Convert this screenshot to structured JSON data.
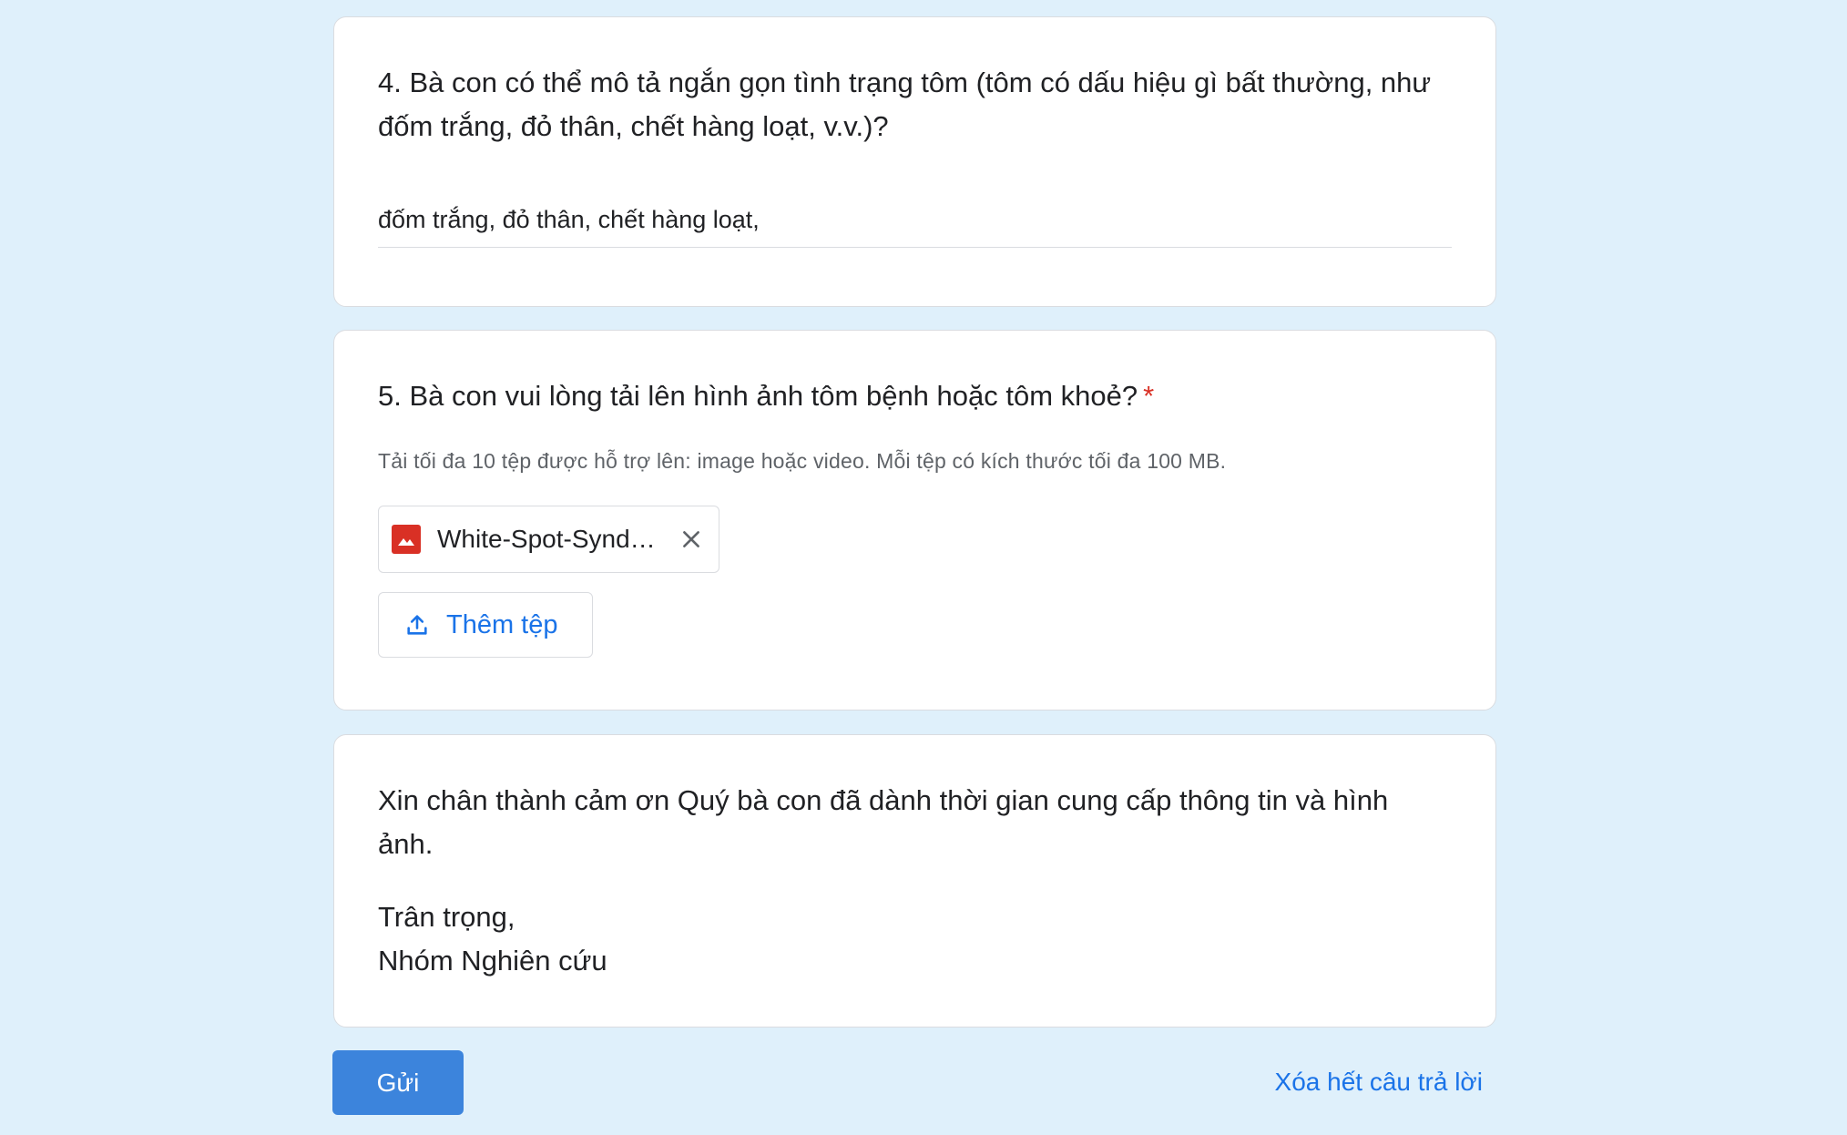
{
  "questions": {
    "q4": {
      "title": "4. Bà con có thể mô tả ngắn gọn tình trạng tôm (tôm có dấu hiệu gì bất thường, như đốm trắng, đỏ thân, chết hàng loạt, v.v.)?",
      "answer": "đốm trắng, đỏ thân, chết hàng loạt,"
    },
    "q5": {
      "title": "5. Bà con vui lòng tải lên hình ảnh tôm bệnh hoặc tôm khoẻ?",
      "required_mark": "*",
      "helper": "Tải tối đa 10 tệp được hỗ trợ lên: image hoặc video. Mỗi tệp có kích thước tối đa 100 MB.",
      "file": {
        "name": "White-Spot-Syndr...",
        "icon": "image-file-icon"
      },
      "add_file_label": "Thêm tệp"
    }
  },
  "closing": {
    "message": "Xin chân thành cảm ơn Quý bà con đã dành thời gian cung cấp thông tin và hình ảnh.",
    "regards": "Trân trọng,",
    "team": "Nhóm Nghiên cứu"
  },
  "actions": {
    "submit_label": "Gửi",
    "clear_label": "Xóa hết câu trả lời"
  },
  "colors": {
    "background": "#dff0fb",
    "accent": "#1a73e8",
    "submit": "#3c84dc",
    "required": "#d93025"
  }
}
